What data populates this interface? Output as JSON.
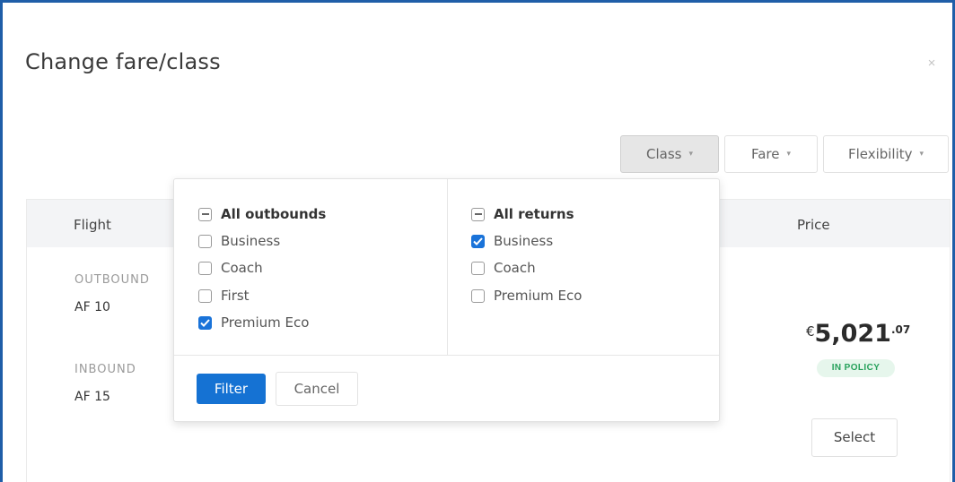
{
  "modal": {
    "title": "Change fare/class",
    "close_glyph": "×"
  },
  "filters": {
    "class_label": "Class",
    "fare_label": "Fare",
    "flexibility_label": "Flexibility",
    "caret_glyph": "▾",
    "active": "Class"
  },
  "table": {
    "col_flight": "Flight",
    "col_price": "Price",
    "outbound_label": "OUTBOUND",
    "outbound_flight": "AF 10",
    "inbound_label": "INBOUND",
    "inbound_flight": "AF 15",
    "price_currency": "€",
    "price_main": "5,021",
    "price_cents": ".07",
    "policy_badge": "IN POLICY",
    "select_label": "Select"
  },
  "class_dropdown": {
    "outbounds": {
      "header": "All outbounds",
      "header_state": "indeterminate",
      "options": [
        {
          "label": "Business",
          "checked": false
        },
        {
          "label": "Coach",
          "checked": false
        },
        {
          "label": "First",
          "checked": false
        },
        {
          "label": "Premium Eco",
          "checked": true
        }
      ]
    },
    "returns": {
      "header": "All returns",
      "header_state": "indeterminate",
      "options": [
        {
          "label": "Business",
          "checked": true
        },
        {
          "label": "Coach",
          "checked": false
        },
        {
          "label": "Premium Eco",
          "checked": false
        }
      ]
    },
    "filter_label": "Filter",
    "cancel_label": "Cancel"
  },
  "colors": {
    "frame_border": "#1f5ea8",
    "primary_button": "#1572d3",
    "checkbox_checked": "#1a73d9",
    "policy_text": "#25a05a",
    "policy_bg": "#e6f6ec"
  },
  "icons": {
    "close": "close-icon",
    "caret": "caret-down-icon",
    "checkbox_checked": "checkmark-icon",
    "checkbox_indeterminate": "minus-icon"
  }
}
